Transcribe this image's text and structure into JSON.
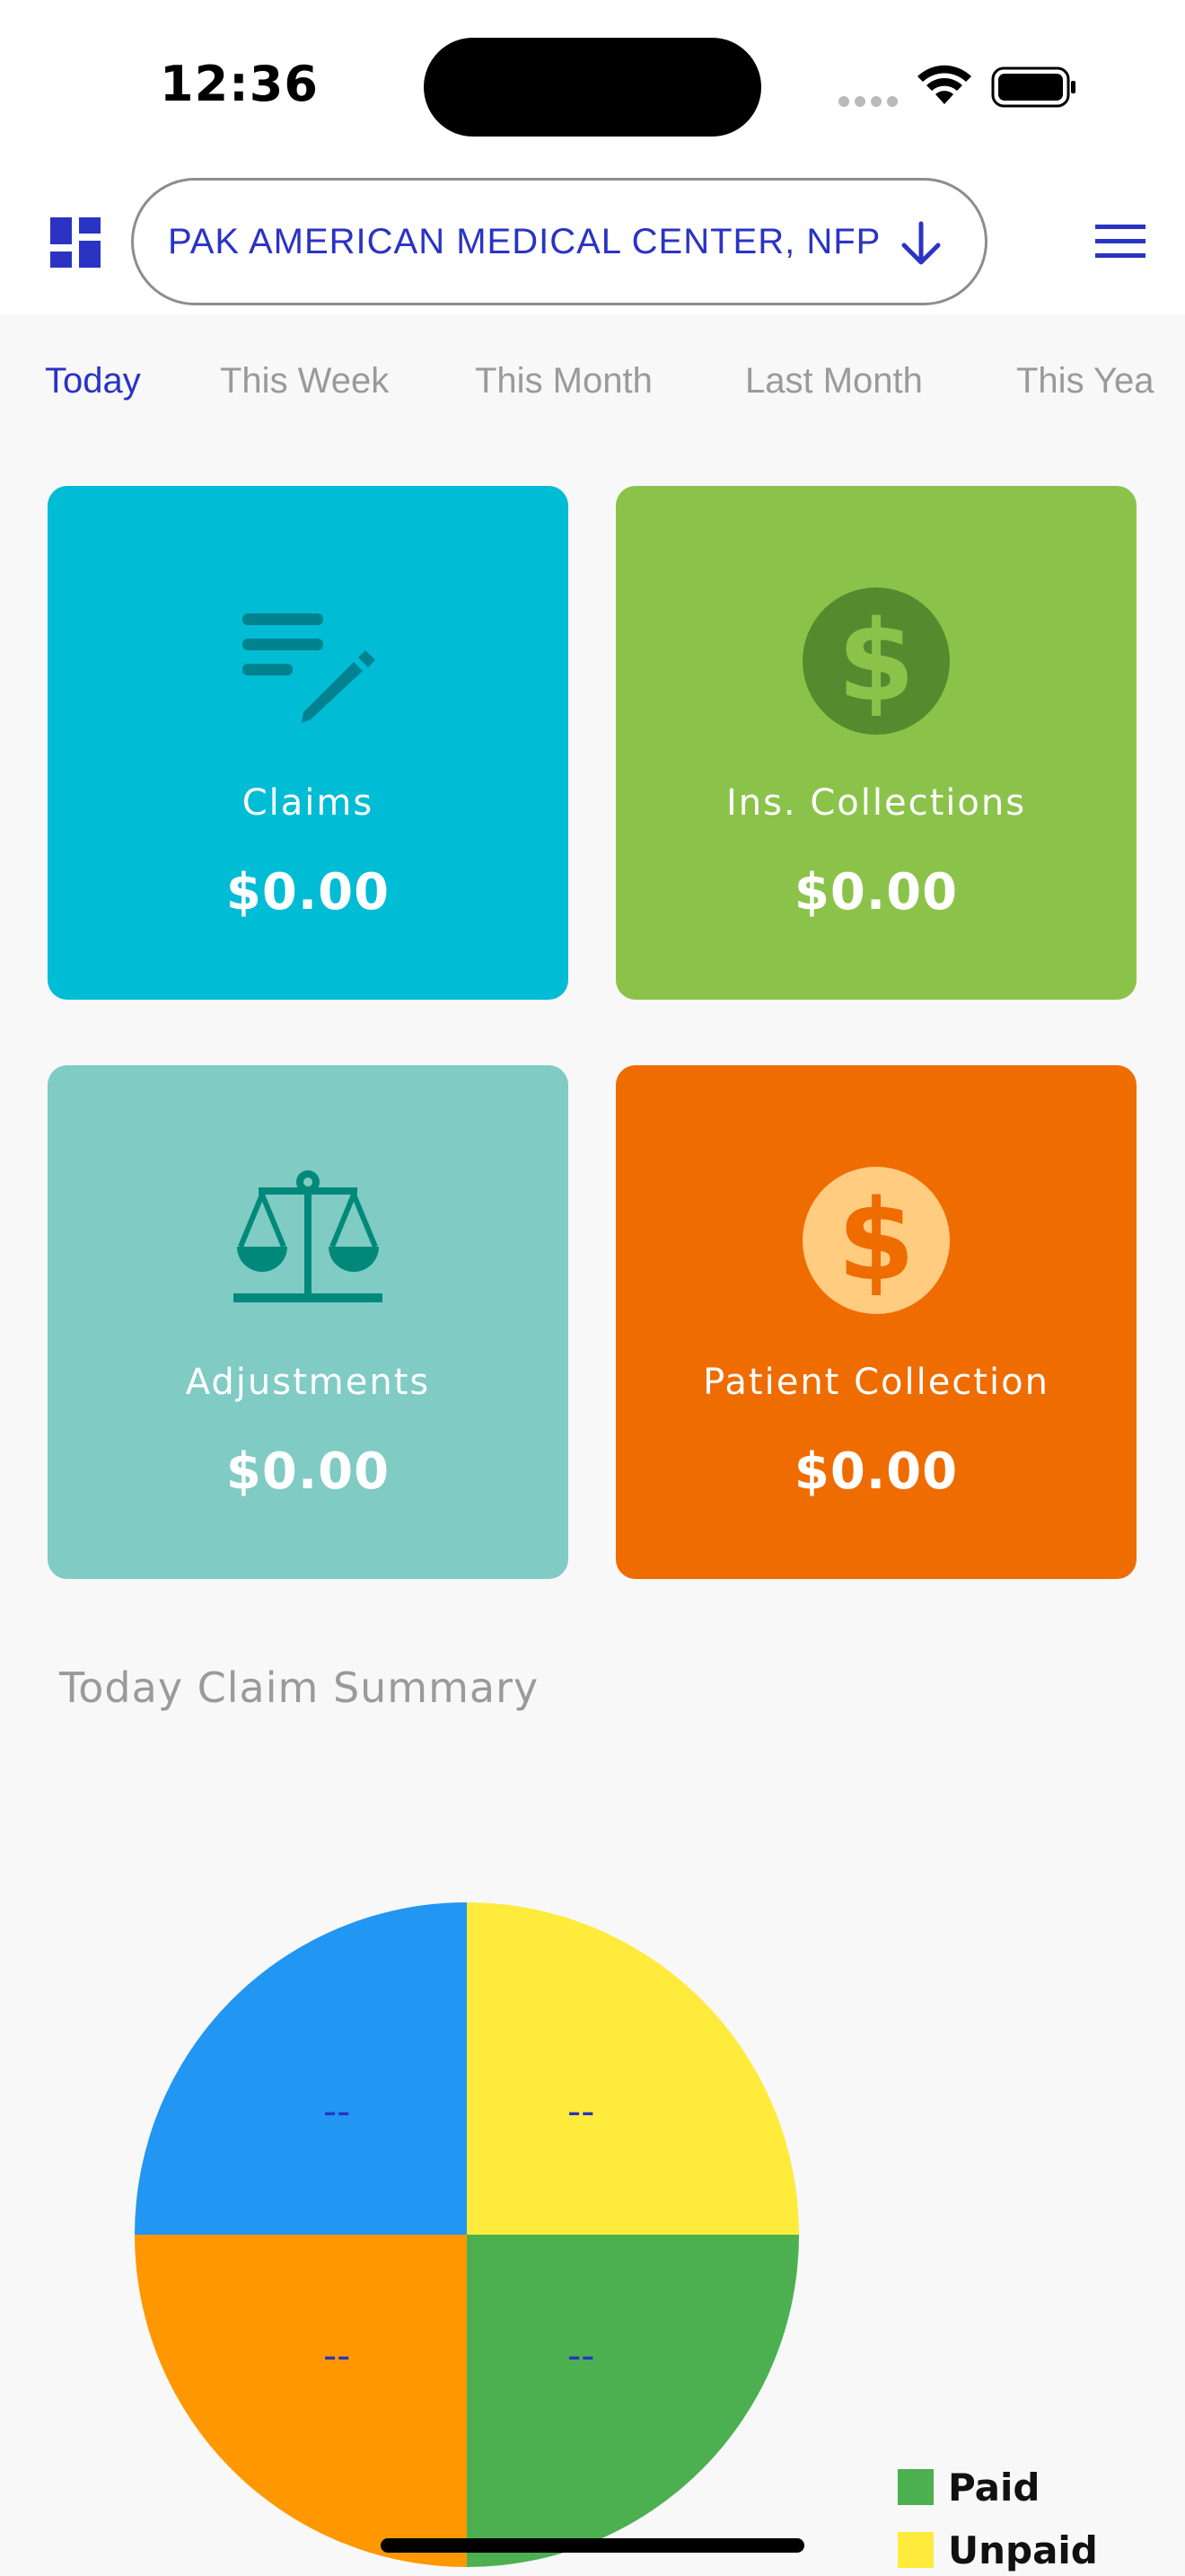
{
  "status_bar": {
    "time": "12:36"
  },
  "header": {
    "organization": "PAK AMERICAN MEDICAL CENTER, NFP",
    "icons": {
      "left": "dashboard-icon",
      "dropdown": "arrow-down-icon",
      "right": "menu-icon"
    }
  },
  "tabs": [
    {
      "label": "Today",
      "active": true
    },
    {
      "label": "This Week",
      "active": false
    },
    {
      "label": "This Month",
      "active": false
    },
    {
      "label": "Last Month",
      "active": false
    },
    {
      "label": "This Yea",
      "active": false
    }
  ],
  "cards": [
    {
      "label": "Claims",
      "amount": "$0.00",
      "color": "#00BCD4",
      "icon": "edit-notes-icon"
    },
    {
      "label": "Ins. Collections",
      "amount": "$0.00",
      "color": "#8BC34A",
      "icon": "dollar-icon"
    },
    {
      "label": "Adjustments",
      "amount": "$0.00",
      "color": "#80CBC4",
      "icon": "balance-scale-icon"
    },
    {
      "label": "Patient Collection",
      "amount": "$0.00",
      "color": "#EF6C00",
      "icon": "dollar-icon"
    }
  ],
  "summary": {
    "title": "Today Claim Summary"
  },
  "chart_data": {
    "type": "pie",
    "slices": [
      {
        "label": "--",
        "value": 25,
        "color": "#FFEB3B"
      },
      {
        "label": "--",
        "value": 25,
        "color": "#4CAF50"
      },
      {
        "label": "--",
        "value": 25,
        "color": "#FF9800"
      },
      {
        "label": "--",
        "value": 25,
        "color": "#2196F3"
      }
    ],
    "legend": [
      {
        "name": "Paid",
        "color": "#4CAF50"
      },
      {
        "name": "Unpaid",
        "color": "#FFEB3B"
      }
    ]
  },
  "colors": {
    "accent": "#2A33C4"
  }
}
